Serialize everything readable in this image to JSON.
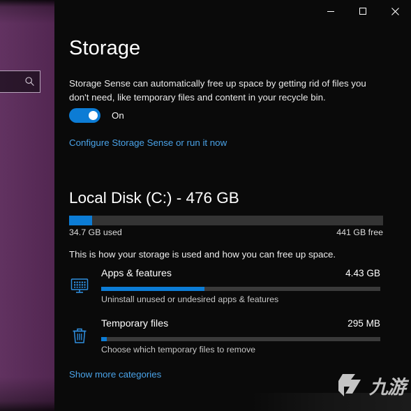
{
  "desktop": {
    "search_box": {
      "value": "",
      "placeholder": "",
      "icon": "search-icon"
    }
  },
  "window": {
    "titlebar": {
      "minimize_label": "─",
      "maximize_label": "☐",
      "close_label": "✕",
      "icons": [
        "minimize-icon",
        "maximize-icon",
        "close-icon"
      ]
    },
    "page_title": "Storage",
    "storage_sense": {
      "description": "Storage Sense can automatically free up space by getting rid of files you don't need, like temporary files and content in your recycle bin.",
      "toggle_state": "On",
      "toggle_on": true,
      "configure_link": "Configure Storage Sense or run it now"
    },
    "disk": {
      "title": "Local Disk (C:) - 476 GB",
      "capacity_gb": 476,
      "used_label": "34.7 GB used",
      "free_label": "441 GB free",
      "used_gb": 34.7,
      "free_gb": 441,
      "used_percent": 7.3
    },
    "howto_text": "This is how your storage is used and how you can free up space.",
    "categories": [
      {
        "name": "Apps & features",
        "size": "4.43 GB",
        "description": "Uninstall unused or undesired apps & features",
        "bar_percent": 37,
        "icon": "apps-monitor-icon"
      },
      {
        "name": "Temporary files",
        "size": "295 MB",
        "description": "Choose which temporary files to remove",
        "bar_percent": 2,
        "icon": "trash-bin-icon"
      }
    ],
    "show_more_link": "Show more categories"
  },
  "watermark": {
    "text": "九游",
    "mark": "g-logo-icon"
  },
  "colors": {
    "accent_blue": "#0c7cd5",
    "link_blue": "#4aa3e8",
    "window_bg": "#0a0a0a",
    "track_gray": "#343434",
    "desktop_purple": "#5a2a59"
  }
}
